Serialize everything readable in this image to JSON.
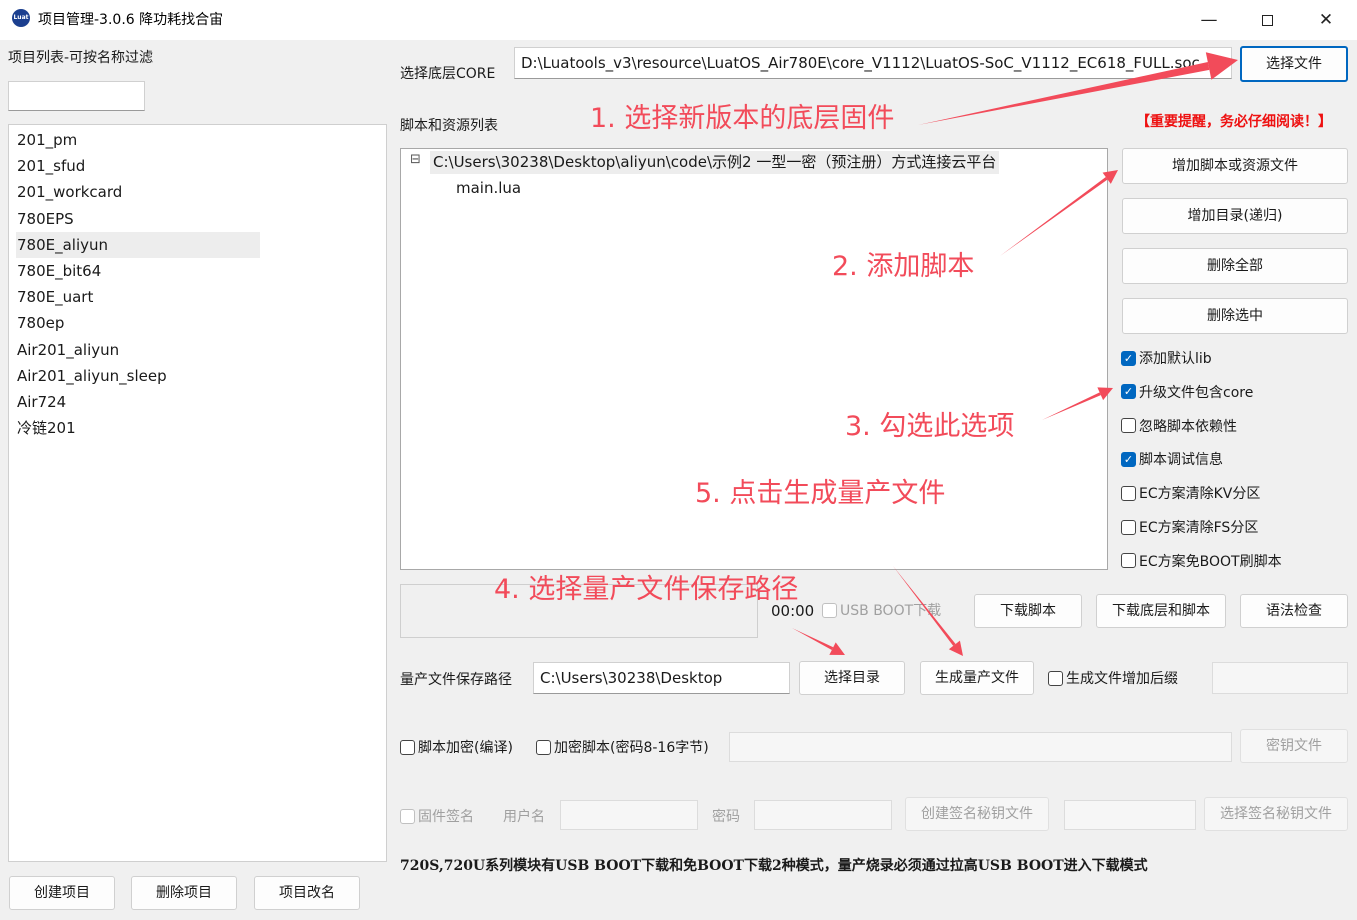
{
  "window": {
    "title": "项目管理-3.0.6 降功耗找合宙",
    "icon_text": "Luat",
    "minimize_icon": "minimize-icon",
    "maximize_icon": "maximize-icon",
    "close_icon": "close-icon"
  },
  "left": {
    "header": "项目列表-可按名称过滤",
    "filter_value": "",
    "projects": [
      "201_pm",
      "201_sfud",
      "201_workcard",
      "780EPS",
      "780E_aliyun",
      "780E_bit64",
      "780E_uart",
      "780ep",
      "Air201_aliyun",
      "Air201_aliyun_sleep",
      "Air724",
      "冷链201"
    ],
    "selected_project": "780E_aliyun",
    "create_button": "创建项目",
    "delete_button": "删除项目",
    "rename_button": "项目改名"
  },
  "core": {
    "label": "选择底层CORE",
    "path": "D:\\Luatools_v3\\resource\\LuatOS_Air780E\\core_V1112\\LuatOS-SoC_V1112_EC618_FULL.soc",
    "select_button": "选择文件"
  },
  "scripts": {
    "label": "脚本和资源列表",
    "warning": "【重要提醒，务必仔细阅读！】",
    "tree_folder": "C:\\Users\\30238\\Desktop\\aliyun\\code\\示例2 一型一密（预注册）方式连接云平台",
    "tree_file": "main.lua",
    "collapse_glyph": "⊟",
    "add_script_button": "增加脚本或资源文件",
    "add_dir_button": "增加目录(递归)",
    "delete_all_button": "删除全部",
    "delete_selected_button": "删除选中"
  },
  "options": [
    {
      "label": "添加默认lib",
      "checked": true
    },
    {
      "label": "升级文件包含core",
      "checked": true
    },
    {
      "label": "忽略脚本依赖性",
      "checked": false
    },
    {
      "label": "脚本调试信息",
      "checked": true
    },
    {
      "label": "EC方案清除KV分区",
      "checked": false
    },
    {
      "label": "EC方案清除FS分区",
      "checked": false
    },
    {
      "label": "EC方案免BOOT刷脚本",
      "checked": false
    }
  ],
  "download": {
    "timer": "00:00",
    "usb_boot_label": "USB BOOT下载",
    "usb_boot_checked": false,
    "download_script_button": "下载脚本",
    "download_core_script_button": "下载底层和脚本",
    "syntax_check_button": "语法检查"
  },
  "mass_production": {
    "path_label": "量产文件保存路径",
    "path_value": "C:\\Users\\30238\\Desktop",
    "select_dir_button": "选择目录",
    "generate_button": "生成量产文件",
    "suffix_label": "生成文件增加后缀",
    "suffix_checked": false,
    "suffix_value": ""
  },
  "encryption": {
    "compile_label": "脚本加密(编译)",
    "compile_checked": false,
    "encrypt_label": "加密脚本(密码8-16字节)",
    "encrypt_checked": false,
    "password_value": "",
    "key_file_button": "密钥文件"
  },
  "signing": {
    "firmware_sign_label": "固件签名",
    "username_label": "用户名",
    "username_value": "",
    "password_label": "密码",
    "password_value": "",
    "create_key_button": "创建签名秘钥文件",
    "key_path_value": "",
    "select_key_button": "选择签名秘钥文件"
  },
  "footer_note": "720S,720U系列模块有USB BOOT下载和免BOOT下载2种模式，量产烧录必须通过拉高USB BOOT进入下载模式",
  "annotations": {
    "step1": "1. 选择新版本的底层固件",
    "step2": "2. 添加脚本",
    "step3": "3. 勾选此选项",
    "step4": "4. 选择量产文件保存路径",
    "step5": "5. 点击生成量产文件",
    "arrow_color": "#f24b5a"
  }
}
